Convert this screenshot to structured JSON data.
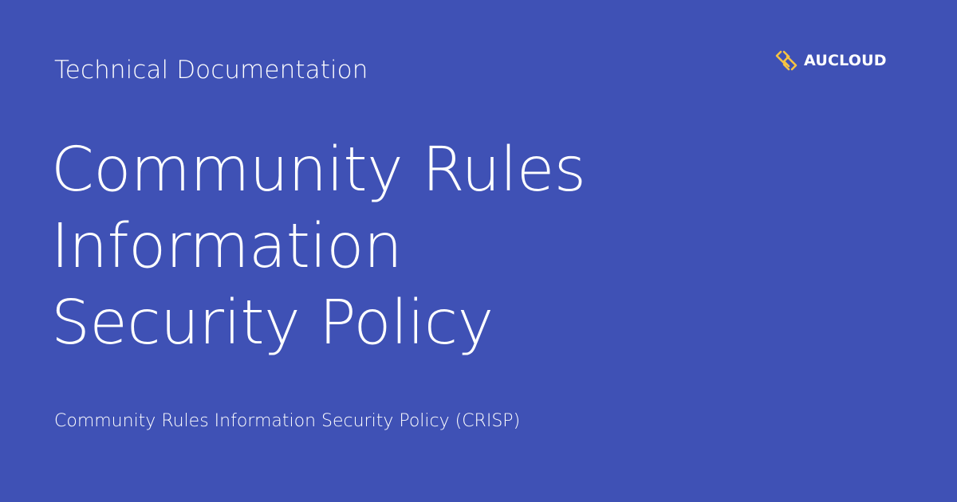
{
  "header": {
    "eyebrow": "Technical Documentation"
  },
  "brand": {
    "name": "AUCLOUD",
    "icon": "aucloud-logo-icon",
    "accent_color": "#f6c343"
  },
  "main": {
    "title_lines": [
      "Community Rules",
      "Information",
      "Security Policy"
    ],
    "subtitle": "Community Rules Information Security Policy (CRISP)"
  },
  "colors": {
    "background": "#3f51b5",
    "text": "#ffffff"
  }
}
